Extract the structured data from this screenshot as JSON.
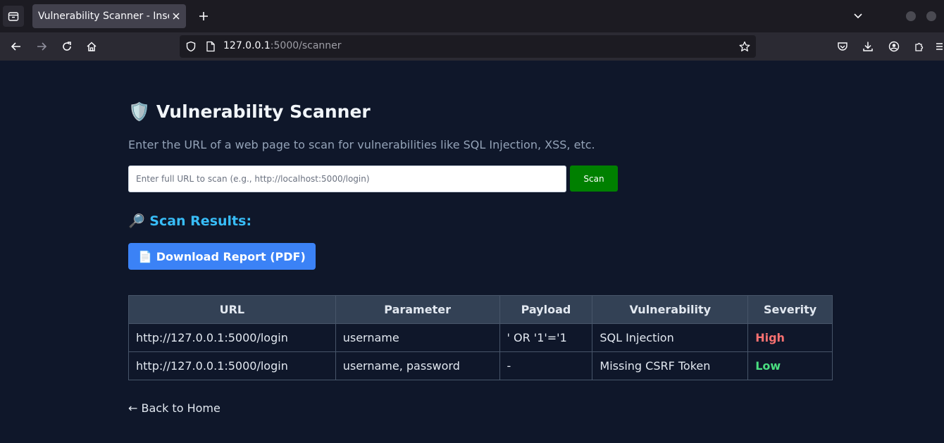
{
  "browser": {
    "tab_title": "Vulnerability Scanner - Insecure",
    "url_host": "127.0.0.1",
    "url_rest": ":5000/scanner"
  },
  "page": {
    "title": "🛡️ Vulnerability Scanner",
    "subtitle": "Enter the URL of a web page to scan for vulnerabilities like SQL Injection, XSS, etc.",
    "input_placeholder": "Enter full URL to scan (e.g., http://localhost:5000/login)",
    "scan_label": "Scan",
    "results_heading": "🔎 Scan Results:",
    "download_label": "📄 Download Report (PDF)",
    "table": {
      "headers": [
        "URL",
        "Parameter",
        "Payload",
        "Vulnerability",
        "Severity"
      ],
      "rows": [
        {
          "url": "http://127.0.0.1:5000/login",
          "parameter": "username",
          "payload": "' OR '1'='1",
          "vulnerability": "SQL Injection",
          "severity": "High"
        },
        {
          "url": "http://127.0.0.1:5000/login",
          "parameter": "username, password",
          "payload": "-",
          "vulnerability": "Missing CSRF Token",
          "severity": "Low"
        }
      ]
    },
    "back_label": "← Back to Home"
  },
  "colors": {
    "background": "#0f172a",
    "accent": "#38bdf8",
    "scan_button": "#008000",
    "download_button": "#3b82f6",
    "severity_high": "#f87171",
    "severity_low": "#4ade80"
  }
}
